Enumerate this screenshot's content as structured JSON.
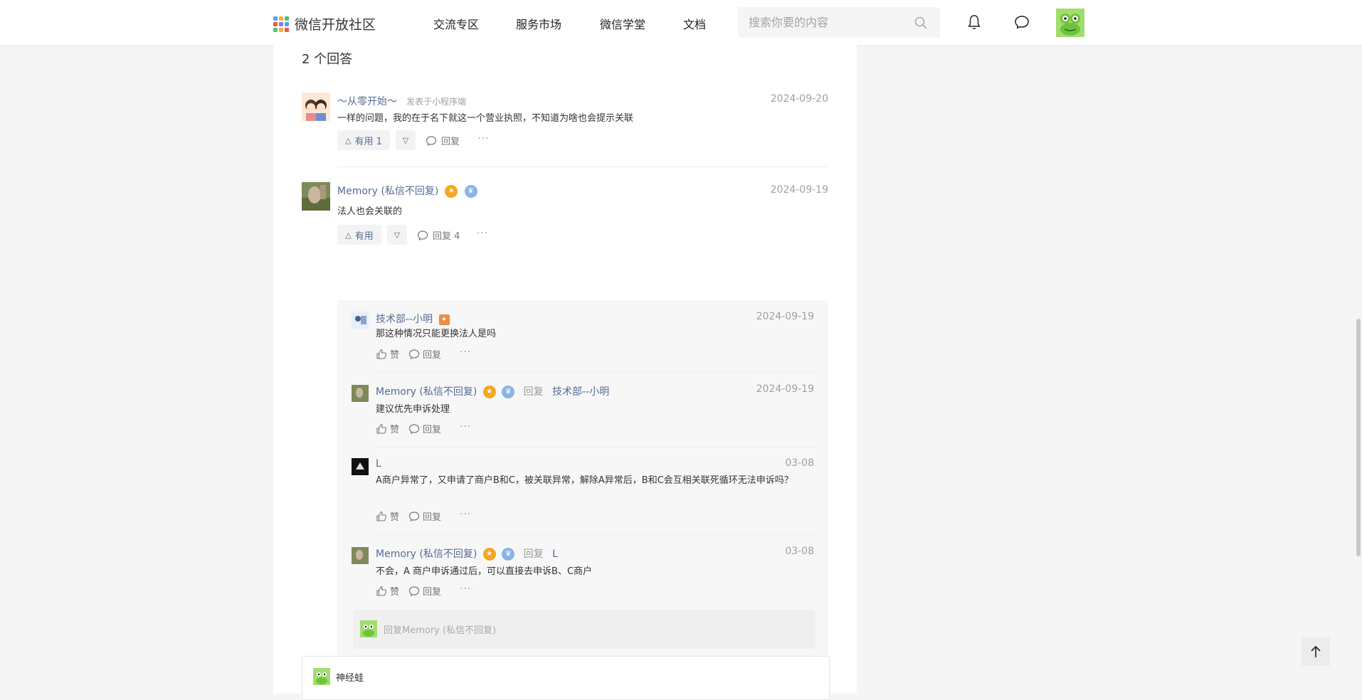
{
  "header": {
    "logo_text": "微信开放社区",
    "nav": [
      "交流专区",
      "服务市场",
      "微信学堂",
      "文档"
    ],
    "search_placeholder": "搜索你要的内容"
  },
  "answers": {
    "count_label": "2 个回答",
    "items": [
      {
        "author": "～从零开始～",
        "posted_in": "发表于小程序端",
        "date": "2024-09-20",
        "text": "一样的问题，我的在于名下就这一个营业执照，不知道为啥也会提示关联",
        "useful_label": "有用 1",
        "reply_label": "回复"
      },
      {
        "author": "Memory (私信不回复)",
        "date": "2024-09-19",
        "text": "法人也会关联的",
        "useful_label": "有用",
        "reply_label": "回复 4"
      }
    ]
  },
  "replies": [
    {
      "author": "技术部--小明",
      "reply_word": "",
      "reply_to": "",
      "date": "2024-09-19",
      "text": "那这种情况只能更换法人是吗"
    },
    {
      "author": "Memory (私信不回复)",
      "reply_word": "回复",
      "reply_to": "技术部--小明",
      "date": "2024-09-19",
      "text": "建议优先申诉处理"
    },
    {
      "author": "L",
      "reply_word": "",
      "reply_to": "",
      "date": "03-08",
      "text": "A商户异常了，又申请了商户B和C，被关联异常，解除A异常后，B和C会互相关联死循环无法申诉吗？"
    },
    {
      "author": "Memory (私信不回复)",
      "reply_word": "回复",
      "reply_to": "L",
      "date": "03-08",
      "text": "不会，A 商户申诉通过后，可以直接去申诉B、C商户"
    }
  ],
  "reply_actions": {
    "like": "赞",
    "reply": "回复"
  },
  "reply_box": {
    "placeholder": "回复Memory (私信不回复)"
  },
  "composer": {
    "user": "神经蛙"
  },
  "colors": {
    "link": "#576b95",
    "muted": "#a0a0a0",
    "badge_gold": "#f5a623",
    "badge_blue": "#8ab4e8"
  }
}
